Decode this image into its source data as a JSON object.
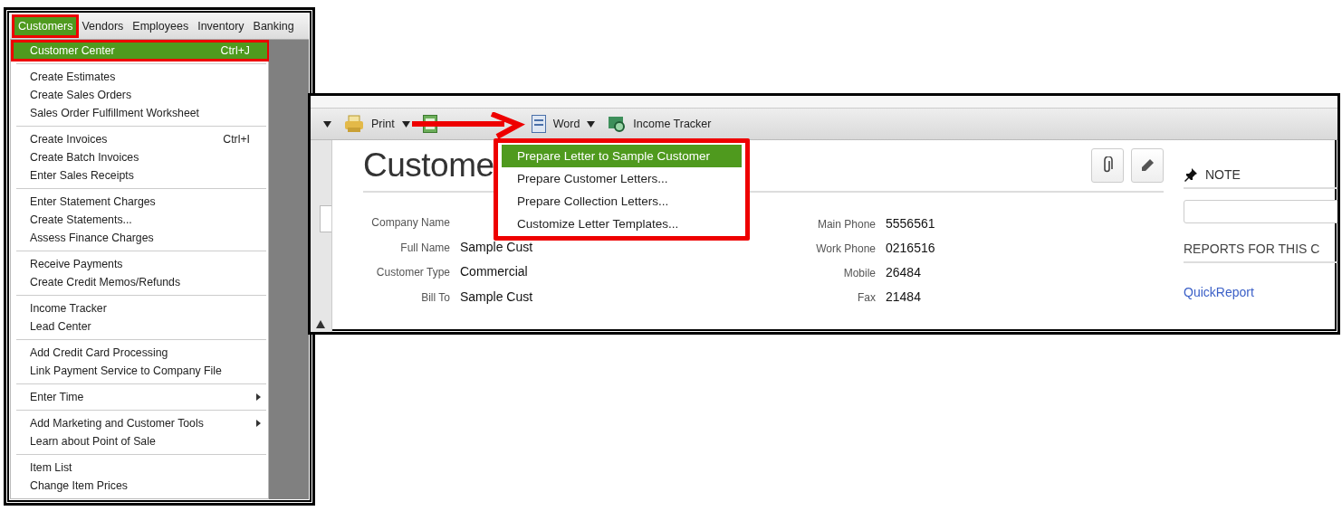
{
  "menu_bar": [
    {
      "label": "Customers",
      "selected": true,
      "highlighted": true
    },
    {
      "label": "Vendors",
      "selected": false,
      "highlighted": false
    },
    {
      "label": "Employees",
      "selected": false,
      "highlighted": false
    },
    {
      "label": "Inventory",
      "selected": false,
      "highlighted": false
    },
    {
      "label": "Banking",
      "selected": false,
      "highlighted": false
    }
  ],
  "menu_sections": [
    [
      {
        "label": "Customer Center",
        "shortcut": "Ctrl+J",
        "submenu": false,
        "selected": true,
        "highlighted": true
      }
    ],
    [
      {
        "label": "Create Estimates",
        "submenu": false,
        "selected": false,
        "highlighted": false
      },
      {
        "label": "Create Sales Orders",
        "submenu": false,
        "selected": false,
        "highlighted": false
      },
      {
        "label": "Sales Order Fulfillment Worksheet",
        "submenu": false,
        "selected": false,
        "highlighted": false
      }
    ],
    [
      {
        "label": "Create Invoices",
        "shortcut": "Ctrl+I",
        "submenu": false,
        "selected": false,
        "highlighted": false
      },
      {
        "label": "Create Batch Invoices",
        "submenu": false,
        "selected": false,
        "highlighted": false
      },
      {
        "label": "Enter Sales Receipts",
        "submenu": false,
        "selected": false,
        "highlighted": false
      }
    ],
    [
      {
        "label": "Enter Statement Charges",
        "submenu": false,
        "selected": false,
        "highlighted": false
      },
      {
        "label": "Create Statements...",
        "submenu": false,
        "selected": false,
        "highlighted": false
      },
      {
        "label": "Assess Finance Charges",
        "submenu": false,
        "selected": false,
        "highlighted": false
      }
    ],
    [
      {
        "label": "Receive Payments",
        "submenu": false,
        "selected": false,
        "highlighted": false
      },
      {
        "label": "Create Credit Memos/Refunds",
        "submenu": false,
        "selected": false,
        "highlighted": false
      }
    ],
    [
      {
        "label": "Income Tracker",
        "submenu": false,
        "selected": false,
        "highlighted": false
      },
      {
        "label": "Lead Center",
        "submenu": false,
        "selected": false,
        "highlighted": false
      }
    ],
    [
      {
        "label": "Add Credit Card Processing",
        "submenu": false,
        "selected": false,
        "highlighted": false
      },
      {
        "label": "Link Payment Service to Company File",
        "submenu": false,
        "selected": false,
        "highlighted": false
      }
    ],
    [
      {
        "label": "Enter Time",
        "submenu": true,
        "selected": false,
        "highlighted": false
      }
    ],
    [
      {
        "label": "Add Marketing and Customer Tools",
        "submenu": true,
        "selected": false,
        "highlighted": false
      },
      {
        "label": "Learn about Point of Sale",
        "submenu": false,
        "selected": false,
        "highlighted": false
      }
    ],
    [
      {
        "label": "Item List",
        "submenu": false,
        "selected": false,
        "highlighted": false
      },
      {
        "label": "Change Item Prices",
        "submenu": false,
        "selected": false,
        "highlighted": false
      }
    ]
  ],
  "toolbar": [
    {
      "kind": "caret"
    },
    {
      "kind": "printer",
      "label": "Print",
      "dropdown": true
    },
    {
      "kind": "spreadsheet",
      "dropdown": false
    },
    {
      "kind": "document",
      "label": "Word",
      "dropdown": true
    },
    {
      "kind": "tracker",
      "label": "Income Tracker",
      "dropdown": false
    }
  ],
  "word_menu": {
    "highlighted": true,
    "items": [
      {
        "label": "Prepare Letter to Sample Customer",
        "selected": true
      },
      {
        "label": "Prepare Customer Letters...",
        "selected": false
      },
      {
        "label": "Prepare Collection Letters...",
        "selected": false
      },
      {
        "label": "Customize Letter Templates...",
        "selected": false
      }
    ]
  },
  "customer": {
    "title": "Custome",
    "fields_left": [
      {
        "label": "Company Name"
      },
      {
        "label": "Full Name",
        "value": "Sample  Cust"
      },
      {
        "label": "Customer Type",
        "value": "Commercial"
      },
      {
        "label": "Bill To",
        "value": "Sample Cust"
      }
    ],
    "fields_right": [
      {
        "label": "Main Phone",
        "value": "5556561"
      },
      {
        "label": "Work Phone",
        "value": "0216516"
      },
      {
        "label": "Mobile",
        "value": "26484"
      },
      {
        "label": "Fax",
        "value": "21484"
      }
    ]
  },
  "note": {
    "title": "NOTE"
  },
  "reports": {
    "title": "REPORTS FOR THIS C",
    "links": [
      "QuickReport"
    ]
  }
}
